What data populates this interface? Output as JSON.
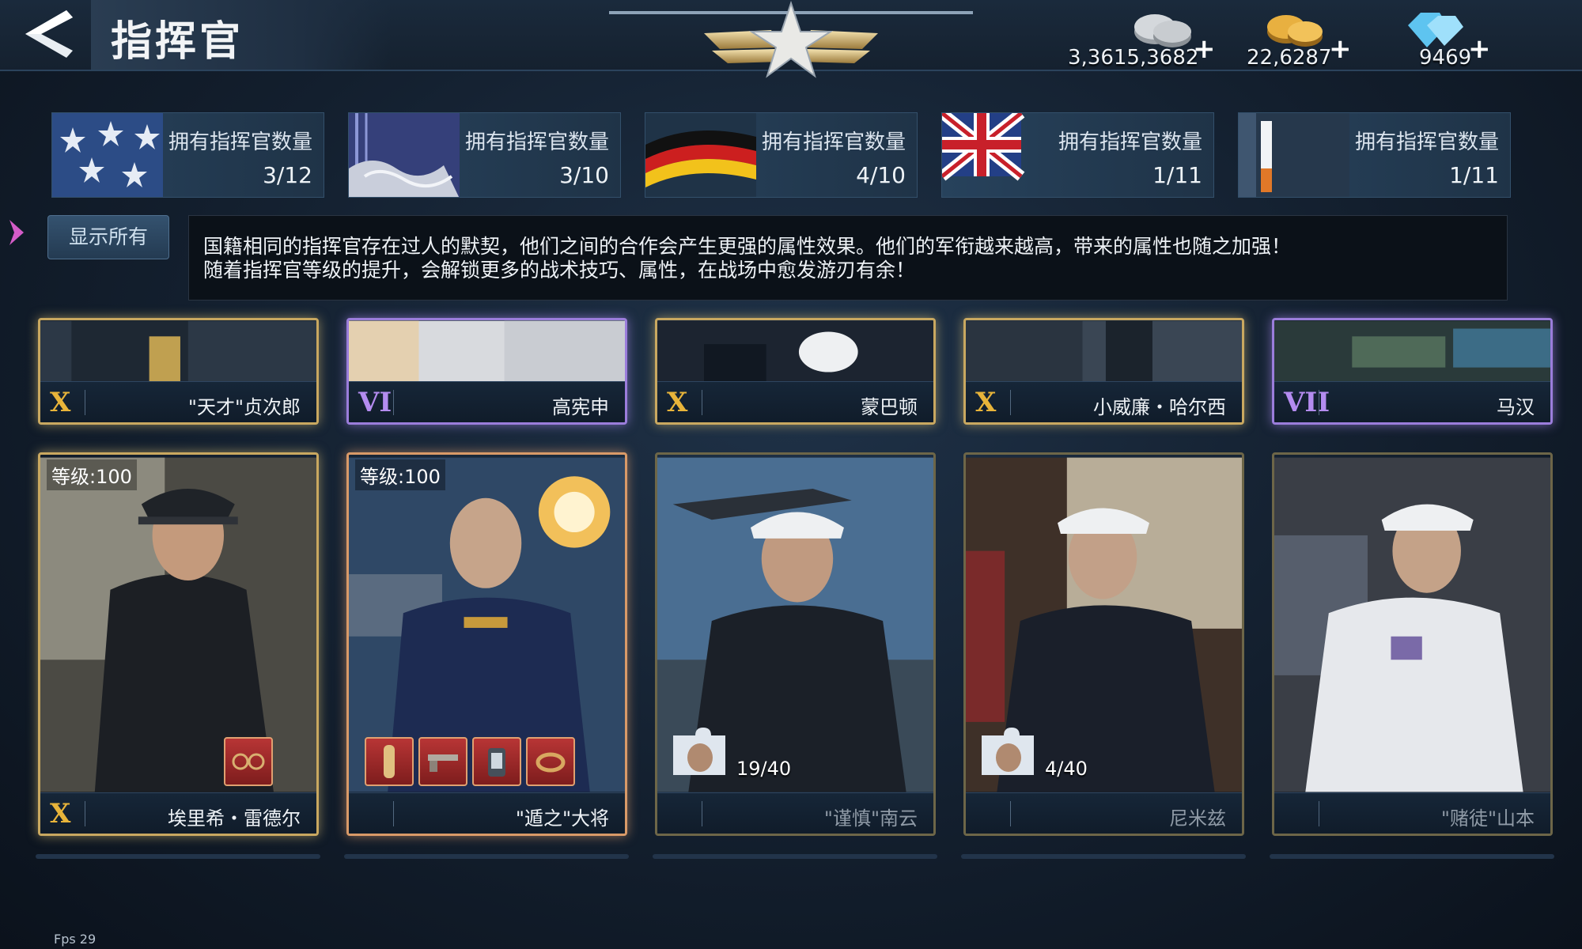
{
  "header": {
    "title": "指挥官",
    "back_icon": "back-arrow-icon"
  },
  "currencies": [
    {
      "name": "silver-coins-icon",
      "amount": "3,3615,3682",
      "plus": "+"
    },
    {
      "name": "gold-coins-icon",
      "amount": "22,6287",
      "plus": "+"
    },
    {
      "name": "diamond-icon",
      "amount": "9469",
      "plus": "+"
    }
  ],
  "nations": [
    {
      "flag": "us-flag-icon",
      "label": "拥有指挥官数量",
      "count": "3/12"
    },
    {
      "flag": "japan-flag-icon",
      "label": "拥有指挥官数量",
      "count": "3/10"
    },
    {
      "flag": "germany-flag-icon",
      "label": "拥有指挥官数量",
      "count": "4/10"
    },
    {
      "flag": "uk-flag-icon",
      "label": "拥有指挥官数量",
      "count": "1/11"
    },
    {
      "flag": "other-flag-icon",
      "label": "拥有指挥官数量",
      "count": "1/11"
    }
  ],
  "show_all": "显示所有",
  "info": {
    "line1": "国籍相同的指挥官存在过人的默契，他们之间的合作会产生更强的属性效果。他们的军衔越来越高，带来的属性也随之加强！",
    "line2": "随着指挥官等级的提升，会解锁更多的战术技巧、属性，在战场中愈发游刃有余！"
  },
  "top_row": [
    {
      "rank": "X",
      "name": "\"天才\"贞次郎",
      "frame": "gold"
    },
    {
      "rank": "VI",
      "name": "高宪申",
      "frame": "purple"
    },
    {
      "rank": "X",
      "name": "蒙巴顿",
      "frame": "gold"
    },
    {
      "rank": "X",
      "name": "小威廉・哈尔西",
      "frame": "gold"
    },
    {
      "rank": "VII",
      "name": "马汉",
      "frame": "purple"
    }
  ],
  "bottom_row": [
    {
      "level": "等级:100",
      "rank": "X",
      "name": "埃里希・雷德尔",
      "frame": "gold",
      "items": [
        "goggles-icon"
      ]
    },
    {
      "level": "等级:100",
      "rank": "",
      "name": "\"遁之\"大将",
      "frame": "orange",
      "items": [
        "medal-icon",
        "pistol-icon",
        "lantern-icon",
        "ring-icon"
      ]
    },
    {
      "fragments": "19/40",
      "name": "\"谨慎\"南云",
      "frame": "dim"
    },
    {
      "fragments": "4/40",
      "name": "尼米兹",
      "frame": "dim"
    },
    {
      "name": "\"赌徒\"山本",
      "frame": "dim"
    }
  ],
  "fps": "Fps 29",
  "colors": {
    "gold_frame": "#c9a860",
    "purple_frame": "#9b7ddb",
    "orange_frame": "#d99a68",
    "rank_gold": "#e8b43a",
    "rank_purple": "#b48cf0",
    "item_red": "#b83535"
  }
}
